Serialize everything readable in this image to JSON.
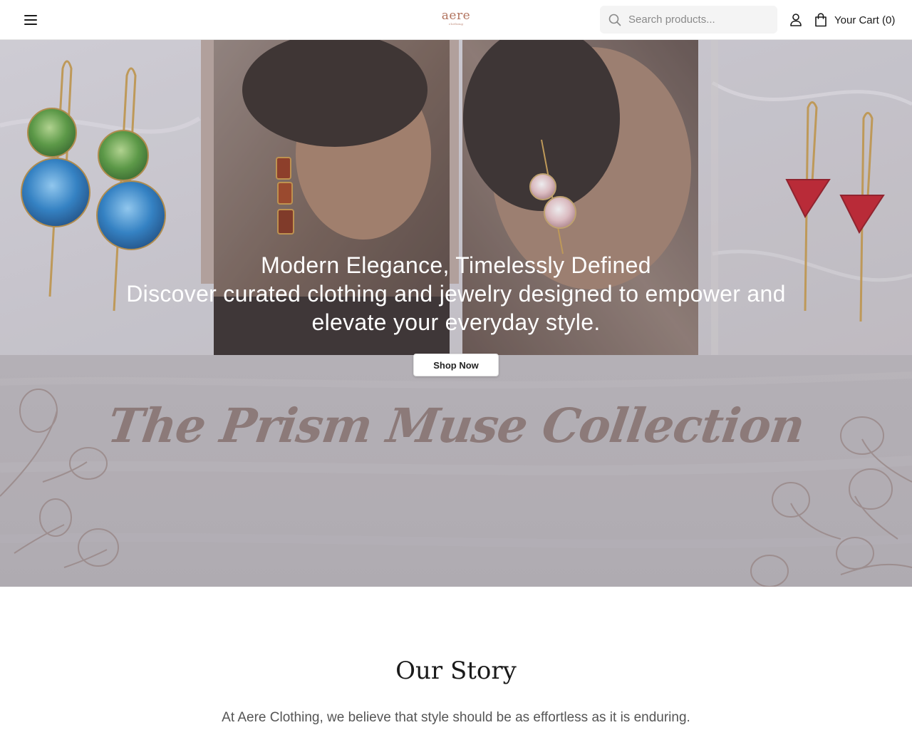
{
  "header": {
    "logo_text": "aere",
    "logo_subtext": "clothing",
    "search_placeholder": "Search products...",
    "cart_label": "Your Cart (0)",
    "icons": {
      "menu": "hamburger-menu-icon",
      "search": "search-icon",
      "user": "user-icon",
      "cart": "shopping-bag-icon"
    }
  },
  "hero": {
    "title": "Modern Elegance, Timelessly Defined",
    "subtitle": "Discover curated clothing and jewelry designed to empower and elevate your everyday style.",
    "cta_label": "Shop Now",
    "collection_title": "The Prism Muse Collection"
  },
  "story": {
    "title": "Our Story",
    "text": "At Aere Clothing, we believe that style should be as effortless as it is enduring."
  },
  "colors": {
    "brand": "#b2745f",
    "collection_text": "#8c7a79",
    "hero_overlay": "#b9b4b9"
  }
}
